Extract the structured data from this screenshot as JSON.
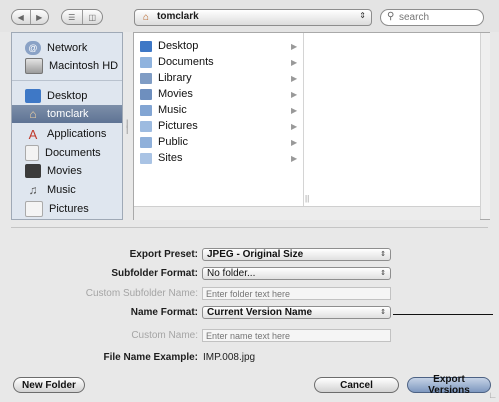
{
  "toolbar": {
    "path": "tomclark",
    "search_placeholder": "search"
  },
  "sidebar": {
    "devices": [
      {
        "label": "Network",
        "icon": "network-icon"
      },
      {
        "label": "Macintosh HD",
        "icon": "hard-drive-icon"
      }
    ],
    "places": [
      {
        "label": "Desktop",
        "icon": "desktop-icon"
      },
      {
        "label": "tomclark",
        "icon": "home-icon",
        "selected": true
      },
      {
        "label": "Applications",
        "icon": "applications-icon"
      },
      {
        "label": "Documents",
        "icon": "documents-icon"
      },
      {
        "label": "Movies",
        "icon": "movies-icon"
      },
      {
        "label": "Music",
        "icon": "music-icon"
      },
      {
        "label": "Pictures",
        "icon": "pictures-icon"
      }
    ]
  },
  "browser": {
    "items": [
      {
        "label": "Desktop",
        "icon": "desktop-folder-icon"
      },
      {
        "label": "Documents",
        "icon": "documents-folder-icon"
      },
      {
        "label": "Library",
        "icon": "library-folder-icon"
      },
      {
        "label": "Movies",
        "icon": "movies-folder-icon"
      },
      {
        "label": "Music",
        "icon": "music-folder-icon"
      },
      {
        "label": "Pictures",
        "icon": "pictures-folder-icon"
      },
      {
        "label": "Public",
        "icon": "public-folder-icon"
      },
      {
        "label": "Sites",
        "icon": "sites-folder-icon"
      }
    ]
  },
  "form": {
    "export_preset": {
      "label": "Export Preset:",
      "value": "JPEG - Original Size"
    },
    "subfolder_format": {
      "label": "Subfolder Format:",
      "value": "No folder..."
    },
    "custom_subfolder_name": {
      "label": "Custom Subfolder Name:",
      "placeholder": "Enter folder text here"
    },
    "name_format": {
      "label": "Name Format:",
      "value": "Current Version Name"
    },
    "custom_name": {
      "label": "Custom Name:",
      "placeholder": "Enter name text here"
    },
    "file_name_example": {
      "label": "File Name Example:",
      "value": "IMP.008.jpg"
    }
  },
  "buttons": {
    "new_folder": "New Folder",
    "cancel": "Cancel",
    "export": "Export Versions"
  },
  "colors": {
    "sidebar_bg": "#dfe6ef",
    "selection": "#6b7f9f",
    "primary_button": "#8ea6c9"
  }
}
